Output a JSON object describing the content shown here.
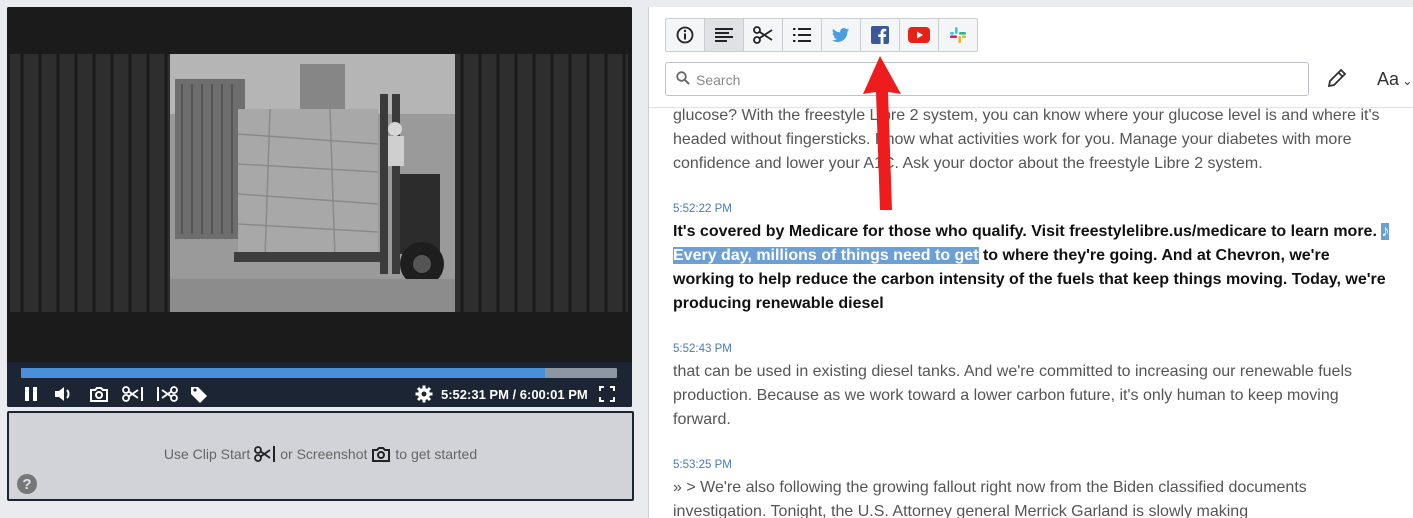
{
  "player": {
    "progress_fraction": 0.88,
    "time_current": "5:52:31 PM",
    "time_total": "/ 6:00:01 PM",
    "colors": {
      "controls_bg": "#1c2533",
      "progress": "#4a90d9"
    }
  },
  "clip": {
    "prefix": "Use Clip Start",
    "middle": "or Screenshot",
    "suffix": "to get started",
    "help": "?"
  },
  "toolbar": {
    "buttons": [
      "info-icon",
      "transcript-icon",
      "clip-icon",
      "list-icon",
      "twitter-icon",
      "facebook-icon",
      "youtube-icon",
      "slack-icon"
    ]
  },
  "search": {
    "placeholder": "Search"
  },
  "font_button": "Aa",
  "transcript": {
    "intro": "glucose? With the freestyle Libre 2 system, you can know where your glucose level is and where it's headed without fingersticks. Know what activities work for you. Manage your diabetes with more confidence and lower your A1C. Ask your doctor about the freestyle Libre 2 system.",
    "segments": [
      {
        "time": "5:52:22 PM",
        "before": "It's covered by Medicare for those who qualify. Visit freestylelibre.us/medicare to learn more. ",
        "highlight": "♪ Every day, millions of things need to get",
        "after": " to where they're going. And at Chevron, we're working to help reduce the carbon intensity of the fuels that keep things moving. Today, we're producing renewable diesel"
      },
      {
        "time": "5:52:43 PM",
        "text": "that can be used in existing diesel tanks. And we're committed to increasing our renewable fuels production. Because as we work toward a lower carbon future, it's only human to keep moving forward."
      },
      {
        "time": "5:53:25 PM",
        "text": "» > We're also following the growing fallout right now from the Biden classified documents investigation. Tonight, the U.S. Attorney general Merrick Garland is slowly making"
      }
    ]
  }
}
